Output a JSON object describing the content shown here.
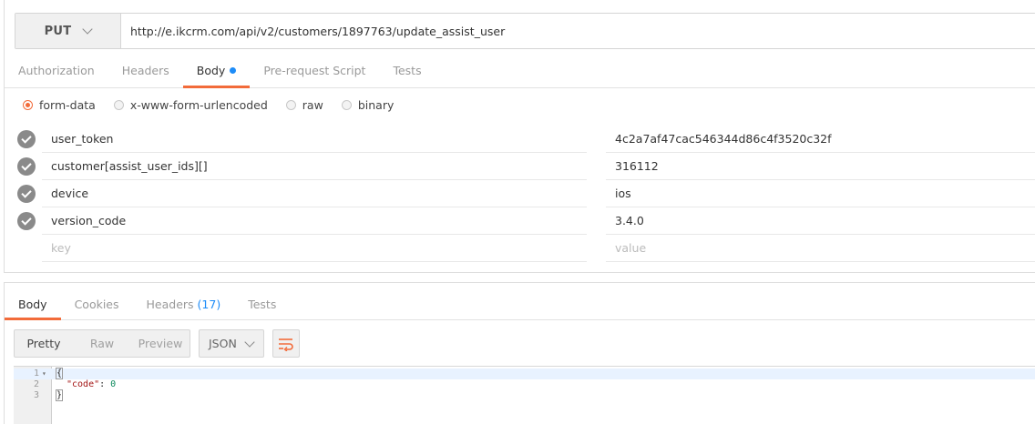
{
  "request": {
    "method": "PUT",
    "url": "http://e.ikcrm.com/api/v2/customers/1897763/update_assist_user",
    "tabs": [
      {
        "label": "Authorization"
      },
      {
        "label": "Headers"
      },
      {
        "label": "Body"
      },
      {
        "label": "Pre-request Script"
      },
      {
        "label": "Tests"
      }
    ],
    "active_tab": "Body",
    "body_types": [
      "form-data",
      "x-www-form-urlencoded",
      "raw",
      "binary"
    ],
    "selected_body_type": "form-data",
    "params": [
      {
        "key": "user_token",
        "value": "4c2a7af47cac546344d86c4f3520c32f"
      },
      {
        "key": "customer[assist_user_ids][]",
        "value": "316112"
      },
      {
        "key": "device",
        "value": "ios"
      },
      {
        "key": "version_code",
        "value": "3.4.0"
      }
    ],
    "key_placeholder": "key",
    "value_placeholder": "value"
  },
  "response": {
    "tabs": [
      {
        "label": "Body"
      },
      {
        "label": "Cookies"
      },
      {
        "label": "Headers",
        "count": "(17)"
      },
      {
        "label": "Tests"
      }
    ],
    "active_tab": "Body",
    "views": [
      "Pretty",
      "Raw",
      "Preview"
    ],
    "active_view": "Pretty",
    "format": "JSON",
    "code_lines": [
      {
        "num": "1",
        "text": "{"
      },
      {
        "num": "2",
        "key": "\"code\"",
        "sep": ": ",
        "value": "0"
      },
      {
        "num": "3",
        "text": "}"
      }
    ]
  },
  "colors": {
    "accent": "#f26b3a",
    "dot_blue": "#1d8cf8"
  }
}
